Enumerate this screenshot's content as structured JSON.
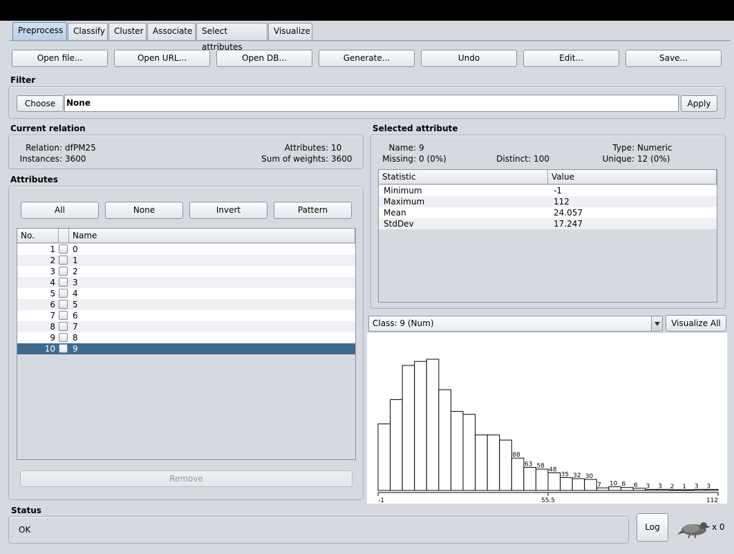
{
  "tabs": [
    {
      "label": "Preprocess",
      "active": true
    },
    {
      "label": "Classify"
    },
    {
      "label": "Cluster"
    },
    {
      "label": "Associate"
    },
    {
      "label": "Select attributes"
    },
    {
      "label": "Visualize"
    }
  ],
  "toolbar": {
    "open_file": "Open file...",
    "open_url": "Open URL...",
    "open_db": "Open DB...",
    "generate": "Generate...",
    "undo": "Undo",
    "edit": "Edit...",
    "save": "Save..."
  },
  "filter": {
    "title": "Filter",
    "choose_label": "Choose",
    "value": "None",
    "apply_label": "Apply"
  },
  "relation": {
    "title": "Current relation",
    "relation_label": "Relation:",
    "relation_value": "dfPM25",
    "instances_label": "Instances:",
    "instances_value": "3600",
    "attributes_label": "Attributes:",
    "attributes_value": "10",
    "weights_label": "Sum of weights:",
    "weights_value": "3600"
  },
  "attributes": {
    "title": "Attributes",
    "all_label": "All",
    "none_label": "None",
    "invert_label": "Invert",
    "pattern_label": "Pattern",
    "col_no": "No.",
    "col_name": "Name",
    "rows": [
      {
        "no": "1",
        "name": "0"
      },
      {
        "no": "2",
        "name": "1"
      },
      {
        "no": "3",
        "name": "2"
      },
      {
        "no": "4",
        "name": "3"
      },
      {
        "no": "5",
        "name": "4"
      },
      {
        "no": "6",
        "name": "5"
      },
      {
        "no": "7",
        "name": "6"
      },
      {
        "no": "8",
        "name": "7"
      },
      {
        "no": "9",
        "name": "8"
      },
      {
        "no": "10",
        "name": "9",
        "selected": true
      }
    ],
    "remove_label": "Remove"
  },
  "selected": {
    "title": "Selected attribute",
    "name_label": "Name:",
    "name_value": "9",
    "missing_label": "Missing:",
    "missing_value": "0 (0%)",
    "distinct_label": "Distinct:",
    "distinct_value": "100",
    "type_label": "Type:",
    "type_value": "Numeric",
    "unique_label": "Unique:",
    "unique_value": "12 (0%)",
    "col_statistic": "Statistic",
    "col_value": "Value",
    "stats": [
      {
        "statistic": "Minimum",
        "value": "-1"
      },
      {
        "statistic": "Maximum",
        "value": "112"
      },
      {
        "statistic": "Mean",
        "value": "24.057"
      },
      {
        "statistic": "StdDev",
        "value": "17.247"
      }
    ]
  },
  "class_select": {
    "value": "Class: 9 (Num)",
    "visualize_all_label": "Visualize All"
  },
  "status": {
    "title": "Status",
    "text": "OK",
    "log_label": "Log",
    "count": "x 0"
  },
  "colors": {
    "bar_fill": "#ffffff",
    "bar_stroke": "#000000",
    "selected_row": "#3e6b90",
    "active_tab": "#b9d0e8"
  },
  "chart_data": {
    "type": "bar",
    "xlim": [
      -1,
      112
    ],
    "x_tick_labels": [
      "-1",
      "55.5",
      "112"
    ],
    "values": [
      181,
      247,
      340,
      351,
      357,
      274,
      215,
      207,
      151,
      151,
      137,
      88,
      63,
      58,
      48,
      35,
      32,
      30,
      7,
      10,
      8,
      6,
      3,
      3,
      2,
      1,
      3,
      3
    ],
    "bar_labels": [
      "",
      "",
      "",
      "",
      "",
      "",
      "",
      "",
      "",
      "",
      "",
      "88",
      "63",
      "58",
      "48",
      "35",
      "32",
      "30",
      "7",
      "10",
      "8",
      "6",
      "3",
      "3",
      "2",
      "1",
      "3",
      "3"
    ]
  }
}
